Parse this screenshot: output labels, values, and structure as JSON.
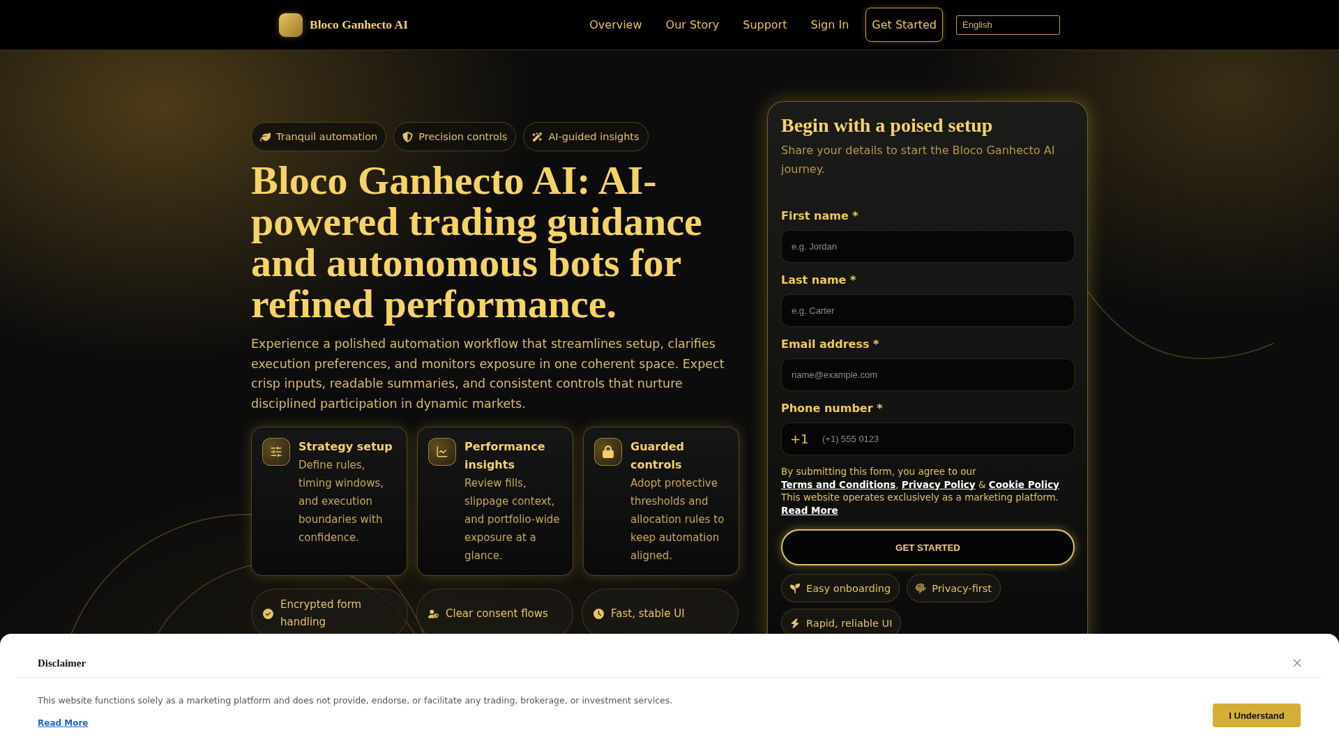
{
  "header": {
    "brand": "Bloco Ganhecto AI",
    "nav": [
      "Overview",
      "Our Story",
      "Support",
      "Sign In"
    ],
    "cta": "Get Started",
    "language": "English"
  },
  "hero": {
    "tags": [
      "Tranquil automation",
      "Precision controls",
      "AI-guided insights"
    ],
    "title": "Bloco Ganhecto AI: AI-powered trading guidance and autonomous bots for refined performance.",
    "description": "Experience a polished automation workflow that streamlines setup, clarifies execution preferences, and monitors exposure in one coherent space. Expect crisp inputs, readable summaries, and consistent controls that nurture disciplined participation in dynamic markets.",
    "features": [
      {
        "title": "Strategy setup",
        "body": "Define rules, timing windows, and execution boundaries with confidence."
      },
      {
        "title": "Performance insights",
        "body": "Review fills, slippage context, and portfolio-wide exposure at a glance."
      },
      {
        "title": "Guarded controls",
        "body": "Adopt protective thresholds and allocation rules to keep automation aligned."
      }
    ],
    "highlights": [
      "Encrypted form handling",
      "Clear consent flows",
      "Fast, stable UI"
    ]
  },
  "signup_form": {
    "title": "Begin with a poised setup",
    "subtitle": "Share your details to start the Bloco Ganhecto AI journey.",
    "fields": [
      {
        "kind": "text",
        "label": "First name *",
        "placeholder": "e.g. Jordan"
      },
      {
        "kind": "text",
        "label": "Last name *",
        "placeholder": "e.g. Carter"
      },
      {
        "kind": "text",
        "label": "Email address *",
        "placeholder": "name@example.com"
      },
      {
        "kind": "phone",
        "label": "Phone number *",
        "prefix": "+1",
        "placeholder": "(+1) 555 0123"
      }
    ],
    "consent": [
      {
        "kind": "text",
        "text": "By submitting this form, you agree to our "
      },
      {
        "kind": "link",
        "text": "Terms and Conditions"
      },
      {
        "kind": "text",
        "text": ", "
      },
      {
        "kind": "link",
        "text": "Privacy Policy"
      },
      {
        "kind": "text",
        "text": " & "
      },
      {
        "kind": "link",
        "text": "Cookie Policy"
      },
      {
        "kind": "text",
        "text": " This website operates exclusively as a marketing platform. "
      },
      {
        "kind": "link",
        "text": "Read More"
      }
    ],
    "submit": "GET STARTED",
    "badges": [
      "Easy onboarding",
      "Privacy-first",
      "Rapid, reliable UI"
    ]
  },
  "disclaimer": {
    "title": "Disclaimer",
    "text": "This website functions solely as a marketing platform and does not provide, endorse, or facilitate any trading, brokerage, or investment services.",
    "link": "Read More",
    "button": "I Understand"
  }
}
